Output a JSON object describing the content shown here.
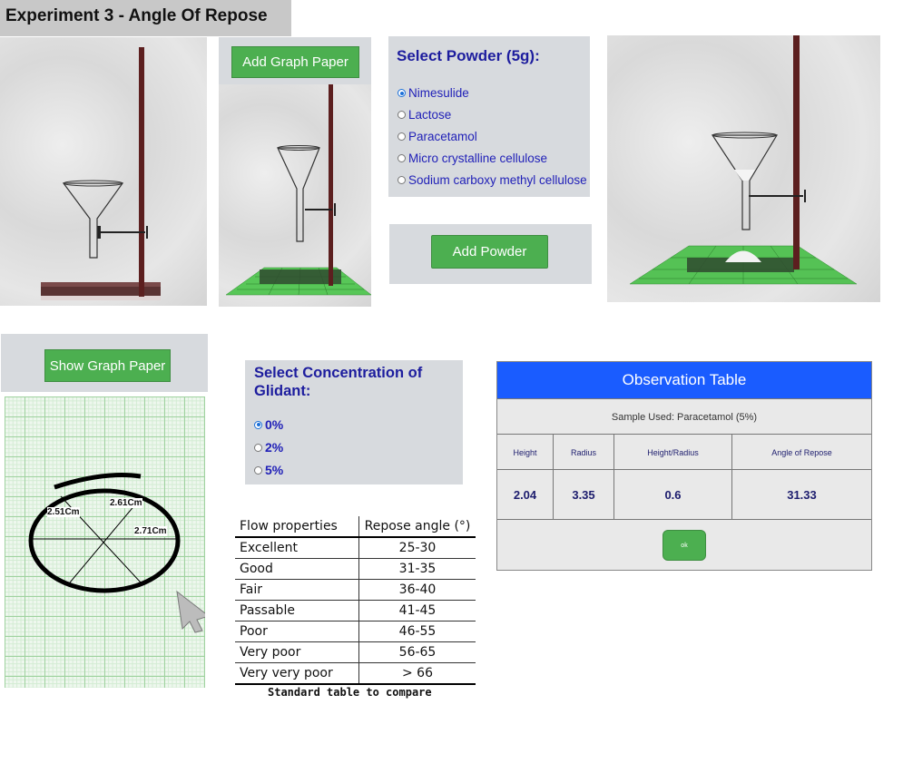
{
  "header": {
    "title": "Experiment 3 - Angle Of Repose"
  },
  "graph_paper_panel": {
    "add_button": "Add Graph Paper"
  },
  "powder_panel": {
    "title": "Select Powder (5g):",
    "options": [
      "Nimesulide",
      "Lactose",
      "Paracetamol",
      "Micro crystalline cellulose",
      "Sodium carboxy methyl cellulose"
    ],
    "selected": "Nimesulide"
  },
  "add_powder": {
    "label": "Add Powder"
  },
  "show_graph": {
    "label": "Show Graph Paper"
  },
  "measurements": {
    "left": "2.51Cm",
    "top": "2.61Cm",
    "right": "2.71Cm"
  },
  "glidant_panel": {
    "title": "Select Concentration of Glidant:",
    "options": [
      "0%",
      "2%",
      "5%"
    ],
    "selected": "0%"
  },
  "standard_table": {
    "headers": [
      "Flow properties",
      "Repose angle (°)"
    ],
    "rows": [
      [
        "Excellent",
        "25-30"
      ],
      [
        "Good",
        "31-35"
      ],
      [
        "Fair",
        "36-40"
      ],
      [
        "Passable",
        "41-45"
      ],
      [
        "Poor",
        "46-55"
      ],
      [
        "Very poor",
        "56-65"
      ],
      [
        "Very very poor",
        "> 66"
      ]
    ],
    "caption": "Standard table to compare"
  },
  "observation": {
    "title": "Observation Table",
    "sample": "Sample Used: Paracetamol (5%)",
    "headers": [
      "Height",
      "Radius",
      "Height/Radius",
      "Angle of Repose"
    ],
    "values": [
      "2.04",
      "3.35",
      "0.6",
      "31.33"
    ],
    "ok": "ok"
  },
  "colors": {
    "green": "#4caf50",
    "blue_header": "#1a5cff",
    "radio_text": "#2121b8",
    "stand": "#5c1f1f"
  }
}
